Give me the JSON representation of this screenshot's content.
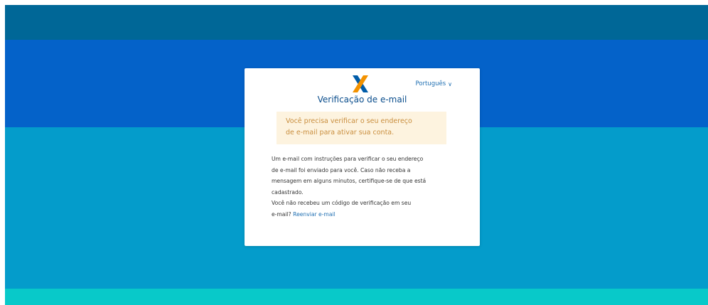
{
  "header": {
    "language_label": "Português",
    "language_chevron": "∨"
  },
  "card": {
    "title": "Verificação de e-mail",
    "notice_line1": "Você precisa verificar o seu endereço",
    "notice_line2": "de e-mail para ativar sua conta.",
    "body_line1": "Um e-mail com instruções para verificar o seu endereço",
    "body_line2": "de e-mail foi enviado para você. Caso não receba a",
    "body_line3": "mensagem em alguns minutos, certifique-se de que está",
    "body_line4": "cadastrado.",
    "body_line5": "Você não recebeu um código de verificação em seu",
    "body_line6_prefix": "e-mail?",
    "resend_link": "Reenviar e-mail"
  },
  "colors": {
    "band_dark": "#006797",
    "band_blue": "#0462c9",
    "band_light": "#049ccb",
    "band_teal": "#08c9c9",
    "logo_orange": "#f39200",
    "logo_blue": "#005ca9",
    "notice_bg": "#fdf3df",
    "notice_text": "#c98e3e",
    "link": "#1f6fb2"
  },
  "icons": {
    "logo": "caixa-x-logo-icon",
    "language_chevron": "chevron-down-icon"
  }
}
